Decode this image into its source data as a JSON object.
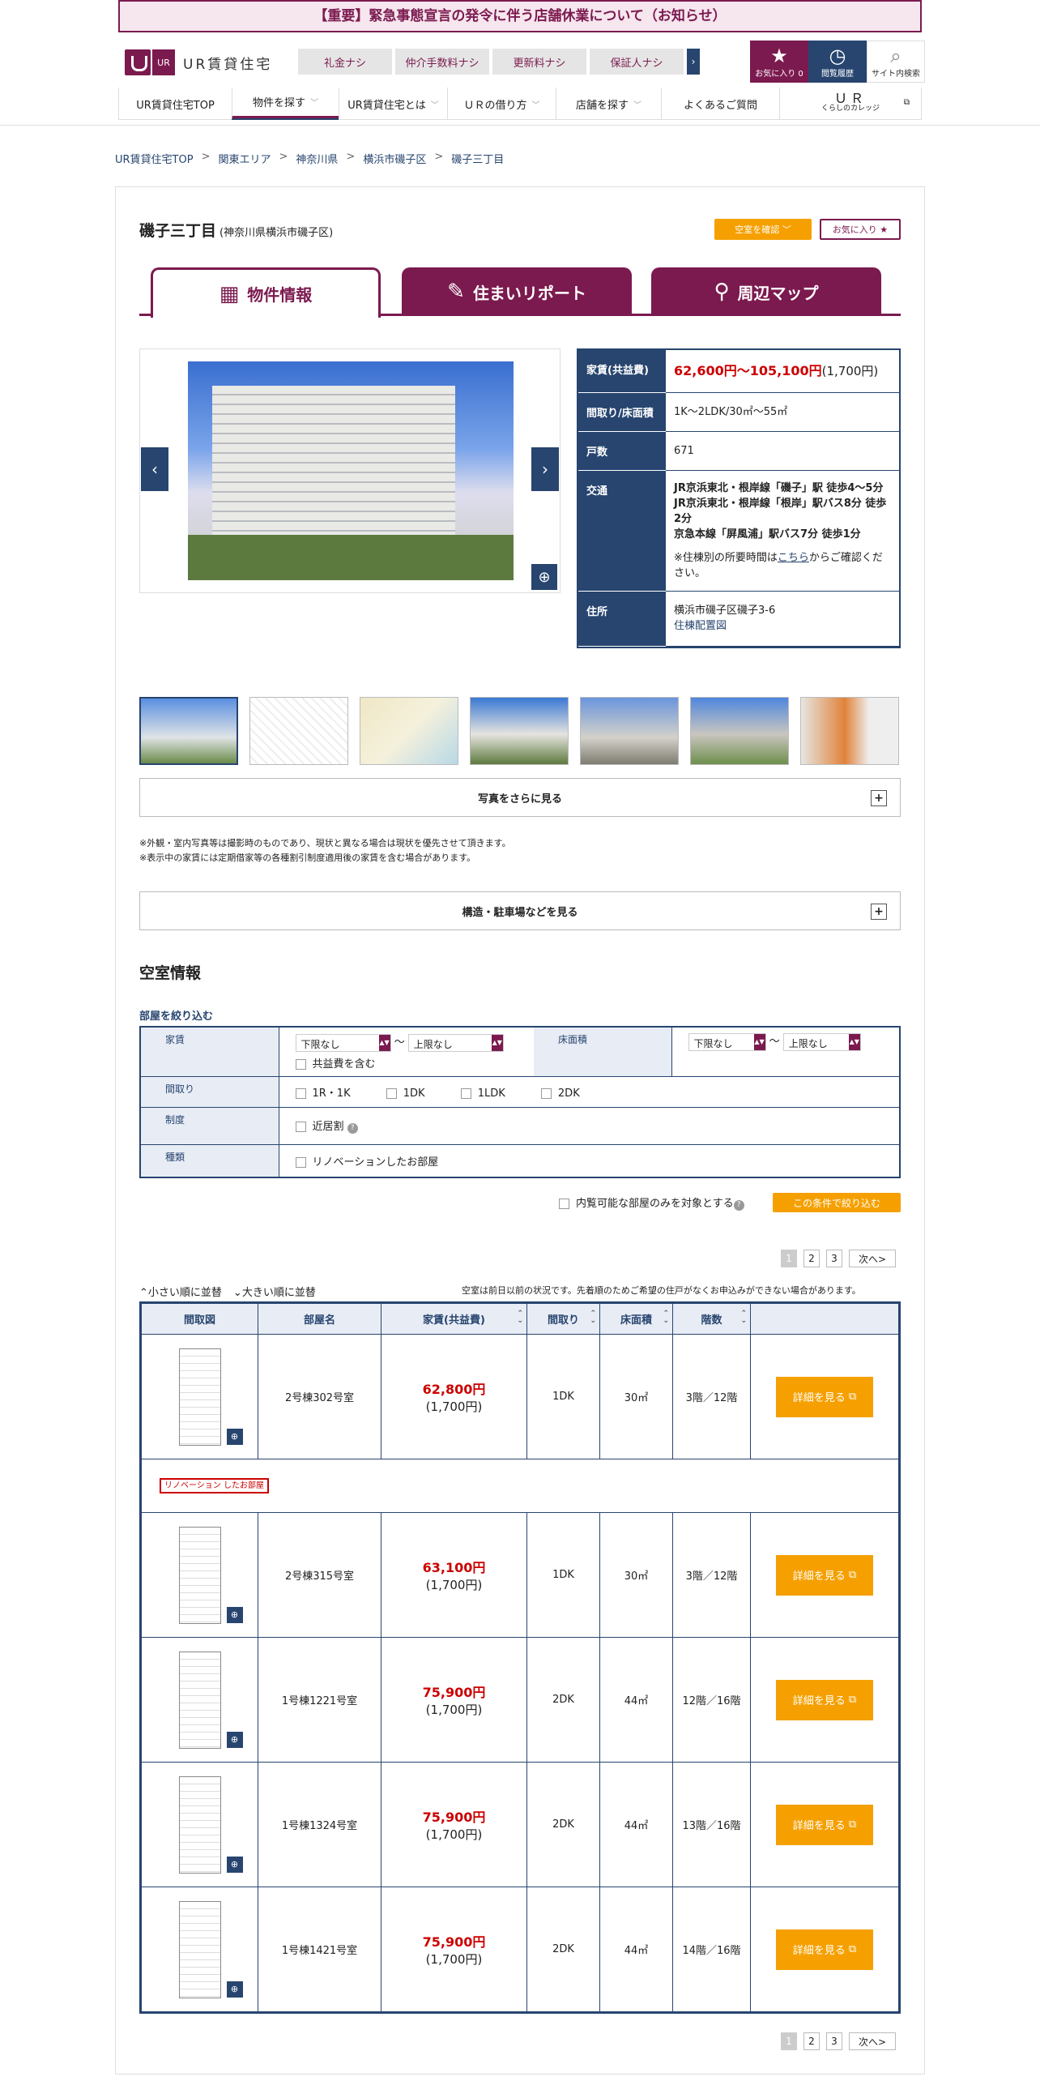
{
  "notice": "【重要】緊急事態宣言の発令に伴う店舗休業について（お知らせ）",
  "header": {
    "logo_ur": "UR",
    "logo_text": "UR賃貸住宅",
    "badges": [
      "礼金ナシ",
      "仲介手数料ナシ",
      "更新料ナシ",
      "保証人ナシ"
    ],
    "badge_more": "›",
    "fav_label": "お気に入り",
    "fav_count": "0",
    "history_label": "閲覧履歴",
    "search_label": "サイト内検索"
  },
  "gnav": {
    "items": [
      "UR賃貸住宅TOP",
      "物件を探す",
      "UR賃貸住宅とは",
      "ＵＲの借り方",
      "店舗を探す",
      "よくあるご質問"
    ],
    "college_top": "ＵＲ",
    "college_bottom": "くらしのカレッジ"
  },
  "breadcrumb": [
    "UR賃貸住宅TOP",
    "関東エリア",
    "神奈川県",
    "横浜市磯子区",
    "磯子三丁目"
  ],
  "property": {
    "name": "磯子三丁目",
    "area": "(神奈川県横浜市磯子区)",
    "vacancy_button": "空室を確認",
    "fav_button": "お気に入り ★"
  },
  "tabs": [
    "物件情報",
    "住まいリポート",
    "周辺マップ"
  ],
  "info": {
    "rent_label": "家賃(共益費)",
    "rent": "62,600円～105,100円",
    "rent_common": "(1,700円)",
    "layout_label": "間取り/床面積",
    "layout": "1K～2LDK/30㎡～55㎡",
    "units_label": "戸数",
    "units": "671",
    "access_label": "交通",
    "access": [
      "JR京浜東北・根岸線「磯子」駅 徒歩4～5分",
      "JR京浜東北・根岸線「根岸」駅バス8分 徒歩2分",
      "京急本線「屏風浦」駅バス7分 徒歩1分"
    ],
    "access_note_pre": "※住棟別の所要時間は",
    "access_note_link": "こちら",
    "access_note_post": "からご確認ください。",
    "address_label": "住所",
    "address": "横浜市磯子区磯子3-6",
    "address_link": "住棟配置図"
  },
  "more_photos": "写真をさらに見る",
  "notes": [
    "※外観・室内写真等は撮影時のものであり、現状と異なる場合は現状を優先させて頂きます。",
    "※表示中の家賃には定期借家等の各種割引制度適用後の家賃を含む場合があります。"
  ],
  "structure": "構造・駐車場などを見る",
  "vacancy": {
    "title": "空室情報",
    "filter_label": "部屋を絞り込む",
    "rent_label": "家賃",
    "rent_min": "下限なし",
    "rent_max": "上限なし",
    "tilde": "〜",
    "common_fee": "共益費を含む",
    "area_label": "床面積",
    "area_min": "下限なし",
    "area_max": "上限なし",
    "layout_label": "間取り",
    "layout_options": [
      "1R・1K",
      "1DK",
      "1LDK",
      "2DK"
    ],
    "system_label": "制度",
    "system_option": "近居割",
    "type_label": "種類",
    "type_option": "リノベーションしたお部屋",
    "viewable_only": "内覧可能な部屋のみを対象とする",
    "filter_button": "この条件で絞り込む",
    "pages": [
      "1",
      "2",
      "3"
    ],
    "next": "次へ>",
    "sort_asc": "小さい順に並替",
    "sort_desc": "大きい順に並替",
    "availability_note": "空室は前日以前の状況です。先着順のためご希望の住戸がなくお申込みができない場合があります。"
  },
  "room_table": {
    "headers": [
      "間取図",
      "部屋名",
      "家賃(共益費)",
      "間取り",
      "床面積",
      "階数",
      ""
    ],
    "renovation_badge": "リノベーション したお部屋",
    "detail_button": "詳細を見る",
    "rows": [
      {
        "name": "2号棟302号室",
        "rent": "62,800円",
        "common": "(1,700円)",
        "layout": "1DK",
        "area": "30㎡",
        "floor": "3階／12階"
      },
      {
        "name": "2号棟315号室",
        "rent": "63,100円",
        "common": "(1,700円)",
        "layout": "1DK",
        "area": "30㎡",
        "floor": "3階／12階"
      },
      {
        "name": "1号棟1221号室",
        "rent": "75,900円",
        "common": "(1,700円)",
        "layout": "2DK",
        "area": "44㎡",
        "floor": "12階／16階"
      },
      {
        "name": "1号棟1324号室",
        "rent": "75,900円",
        "common": "(1,700円)",
        "layout": "2DK",
        "area": "44㎡",
        "floor": "13階／16階"
      },
      {
        "name": "1号棟1421号室",
        "rent": "75,900円",
        "common": "(1,700円)",
        "layout": "2DK",
        "area": "44㎡",
        "floor": "14階／16階"
      }
    ]
  },
  "colors": {
    "brand": "#7b1a4f",
    "navy": "#27456f",
    "orange": "#f5a000",
    "price_red": "#cc0000"
  }
}
